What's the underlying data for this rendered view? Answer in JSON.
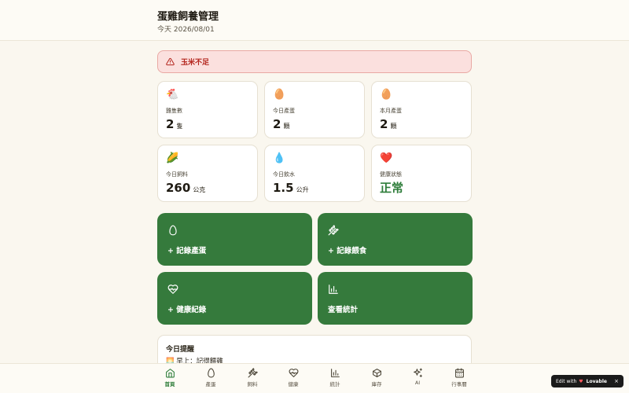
{
  "header": {
    "title": "蛋雞飼養管理",
    "date": "今天 2026/08/01"
  },
  "alert": {
    "text": "玉米不足",
    "icon": "warning-triangle-icon"
  },
  "stats": [
    {
      "emoji": "🐔",
      "label": "雞隻數",
      "value": "2",
      "unit": "隻"
    },
    {
      "emoji": "🥚",
      "label": "今日產蛋",
      "value": "2",
      "unit": "顆"
    },
    {
      "emoji": "🥚",
      "label": "本月產蛋",
      "value": "2",
      "unit": "顆"
    },
    {
      "emoji": "🌽",
      "label": "今日飼料",
      "value": "260",
      "unit": "公克"
    },
    {
      "emoji": "💧",
      "label": "今日飲水",
      "value": "1.5",
      "unit": "公升"
    },
    {
      "emoji": "❤️",
      "label": "健康狀態",
      "value": "正常",
      "unit": ""
    }
  ],
  "actions": [
    {
      "label": "+ 記錄產蛋",
      "icon": "egg-icon"
    },
    {
      "label": "+ 記錄餵食",
      "icon": "wheat-icon"
    },
    {
      "label": "+ 健康紀錄",
      "icon": "heart-pulse-icon"
    },
    {
      "label": "查看統計",
      "icon": "bar-chart-icon"
    }
  ],
  "reminder": {
    "title": "今日提醒",
    "item": "🌅 早上：記得餵雞"
  },
  "nav": [
    {
      "label": "首頁",
      "icon": "home-icon",
      "active": true
    },
    {
      "label": "產蛋",
      "icon": "egg-icon"
    },
    {
      "label": "飼料",
      "icon": "wheat-icon"
    },
    {
      "label": "健康",
      "icon": "heart-pulse-icon"
    },
    {
      "label": "統計",
      "icon": "bar-chart-icon"
    },
    {
      "label": "庫存",
      "icon": "box-icon"
    },
    {
      "label": "AI",
      "icon": "sparkles-icon"
    },
    {
      "label": "行事曆",
      "icon": "calendar-icon"
    }
  ],
  "badge": {
    "prefix": "Edit with",
    "brand": "Lovable",
    "close": "×"
  },
  "colors": {
    "primary": "#357a3c",
    "alert_bg": "#fbe0de",
    "alert_text": "#b4251d",
    "background": "#faf7ef"
  }
}
